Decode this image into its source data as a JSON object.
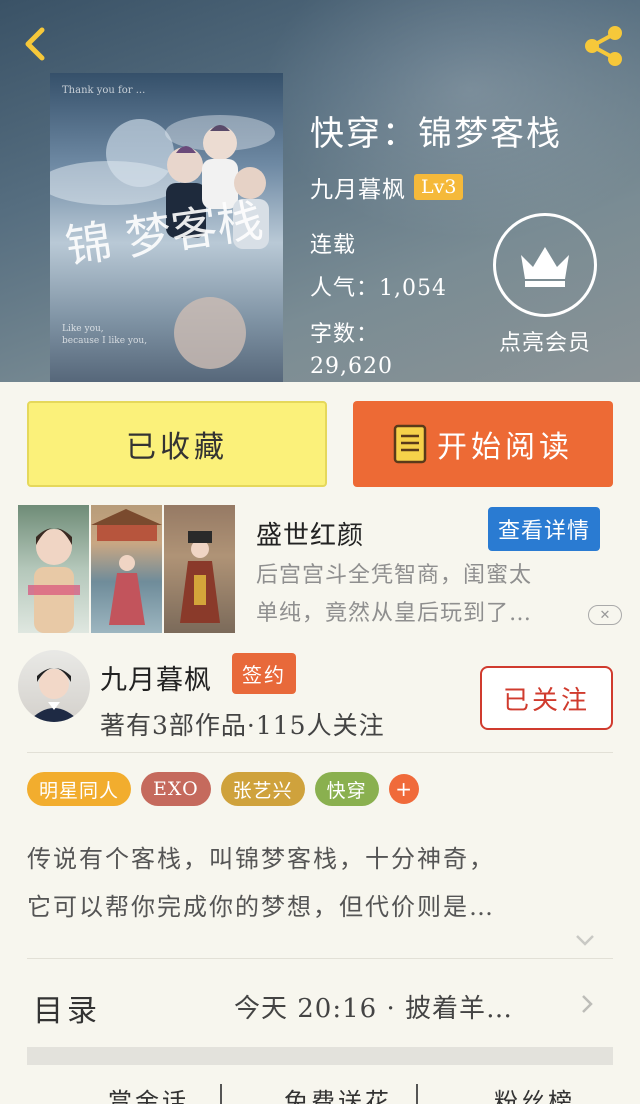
{
  "book": {
    "title": "快穿：锦梦客栈",
    "author": "九月暮枫",
    "level": "Lv3",
    "status": "连载",
    "popularity": "人气：1,054",
    "words_label": "字数：",
    "words_value": "29,620"
  },
  "vip": {
    "label": "点亮会员"
  },
  "actions": {
    "collected_label": "已收藏",
    "read_label": "开始阅读"
  },
  "ad": {
    "title": "盛世红颜",
    "detail_label": "查看详情",
    "desc_line1": "后宫宫斗全凭智商，闺蜜太",
    "desc_line2": "单纯，竟然从皇后玩到了…",
    "close": "✕"
  },
  "author": {
    "name": "九月暮枫",
    "badge": "签约",
    "stats": "著有3部作品·115人关注",
    "follow_label": "已关注"
  },
  "tags": [
    {
      "label": "明星同人",
      "color": "#f2ad2e"
    },
    {
      "label": "EXO",
      "color": "#c56a5d"
    },
    {
      "label": "张艺兴",
      "color": "#cfa23c"
    },
    {
      "label": "快穿",
      "color": "#8ab04f"
    }
  ],
  "tag_add": "+",
  "synopsis": {
    "line1": "传说有个客栈，叫锦梦客栈，十分神奇，",
    "line2": "它可以帮你完成你的梦想，但代价则是…"
  },
  "toc": {
    "label": "目录",
    "latest": "今天 20:16 · 披着羊…"
  },
  "bottom_tabs": [
    "赏金话",
    "免费送花",
    "粉丝榜"
  ],
  "colors": {
    "accent_orange": "#ed6a35",
    "collected_yellow": "#fbf17a",
    "follow_red": "#d03b2e",
    "badge_blue": "#2a7bd2"
  }
}
